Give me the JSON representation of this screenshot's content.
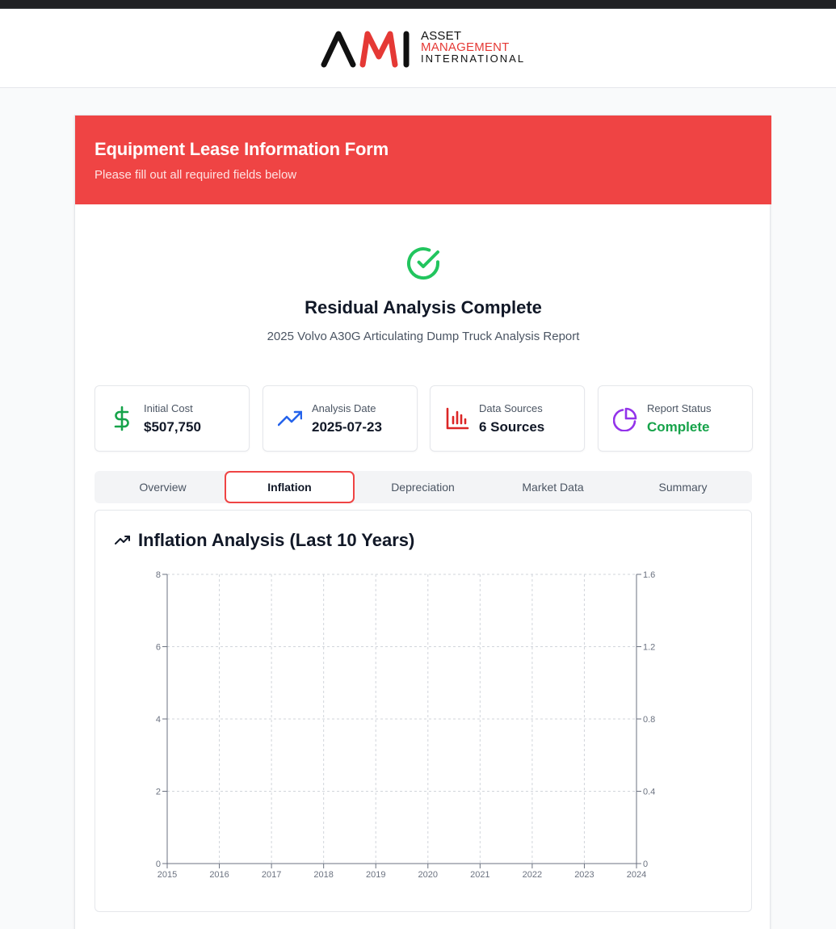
{
  "brand": {
    "logo_mark": "AMI",
    "line1": "ASSET",
    "line2": "MANAGEMENT",
    "line3": "INTERNATIONAL"
  },
  "form": {
    "title": "Equipment Lease Information Form",
    "subtitle": "Please fill out all required fields below"
  },
  "result": {
    "icon": "check-circle-icon",
    "title": "Residual Analysis Complete",
    "subtitle": "2025 Volvo A30G Articulating Dump Truck Analysis Report"
  },
  "stats": [
    {
      "icon": "dollar-icon",
      "label": "Initial Cost",
      "value": "$507,750",
      "color": "#16a34a"
    },
    {
      "icon": "trending-up-icon",
      "label": "Analysis Date",
      "value": "2025-07-23",
      "color": "#2563eb"
    },
    {
      "icon": "bar-chart-icon",
      "label": "Data Sources",
      "value": "6 Sources",
      "color": "#dc2626"
    },
    {
      "icon": "pie-chart-icon",
      "label": "Report Status",
      "value": "Complete",
      "color": "#9333ea"
    }
  ],
  "tabs": [
    {
      "label": "Overview",
      "active": false
    },
    {
      "label": "Inflation",
      "active": true
    },
    {
      "label": "Depreciation",
      "active": false
    },
    {
      "label": "Market Data",
      "active": false
    },
    {
      "label": "Summary",
      "active": false
    }
  ],
  "chart_section": {
    "icon": "trending-up-icon",
    "title": "Inflation Analysis (Last 10 Years)"
  },
  "chart_data": {
    "type": "line",
    "title": "",
    "xlabel": "",
    "ylabel": "",
    "x": [
      "2015",
      "2016",
      "2017",
      "2018",
      "2019",
      "2020",
      "2021",
      "2022",
      "2023",
      "2024"
    ],
    "series": [],
    "y_left": {
      "ticks": [
        "0",
        "2",
        "4",
        "6",
        "8"
      ],
      "ylim": [
        0,
        8
      ]
    },
    "y_right": {
      "ticks": [
        "0",
        "0.4",
        "0.8",
        "1.2",
        "1.6"
      ],
      "ylim": [
        0,
        1.6
      ]
    },
    "grid": true
  },
  "colors": {
    "accent": "#ef4444",
    "success": "#22c55e"
  }
}
